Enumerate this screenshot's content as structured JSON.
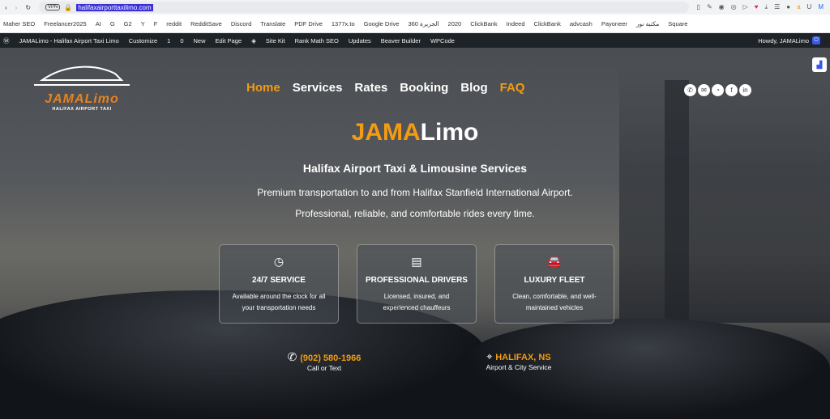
{
  "browser": {
    "url": "halifaxairporttaxilimo.com",
    "vpn": "VPN"
  },
  "bookmarks": [
    "Maher SEO",
    "Freelancer2025",
    "AI",
    "G",
    "G2",
    "Y",
    "F",
    "reddit",
    "RedditSave",
    "Discord",
    "Translate",
    "PDF Drive",
    "1377x.to",
    "Google Drive",
    "الجزيرة 360",
    "2020",
    "ClickBank",
    "Indeed",
    "ClickBank",
    "advcash",
    "Payoneer",
    "مكتبة نور",
    "Square"
  ],
  "wpbar": {
    "site": "JAMALimo - Halifax Airport Taxi Limo",
    "customize": "Customize",
    "updates_count": "1",
    "comments_count": "0",
    "new": "New",
    "edit": "Edit Page",
    "sitekit": "Site Kit",
    "rankmath": "Rank Math SEO",
    "updates": "Updates",
    "beaver": "Beaver Builder",
    "wpcode": "WPCode",
    "howdy": "Howdy, JAMALimo"
  },
  "logo": {
    "name": "JAMALimo",
    "sub": "HALIFAX AIRPORT TAXI"
  },
  "nav": [
    "Home",
    "Services",
    "Rates",
    "Booking",
    "Blog",
    "FAQ"
  ],
  "hero": {
    "title_a": "JAMA",
    "title_b": "Limo",
    "subtitle": "Halifax Airport Taxi & Limousine Services",
    "line1": "Premium transportation to and from Halifax Stanfield International Airport.",
    "line2": "Professional, reliable, and comfortable rides every time."
  },
  "cards": [
    {
      "title": "24/7 SERVICE",
      "d1": "Available around the clock for all",
      "d2": "your transportation needs"
    },
    {
      "title": "PROFESSIONAL DRIVERS",
      "d1": "Licensed, insured, and",
      "d2": "experienced chauffeurs"
    },
    {
      "title": "LUXURY FLEET",
      "d1": "Clean, comfortable, and well-",
      "d2": "maintained vehicles"
    }
  ],
  "contact": [
    {
      "value": "(902) 580-1966",
      "label": "Call or Text"
    },
    {
      "value": "HALIFAX, NS",
      "label": "Airport & City Service"
    }
  ]
}
